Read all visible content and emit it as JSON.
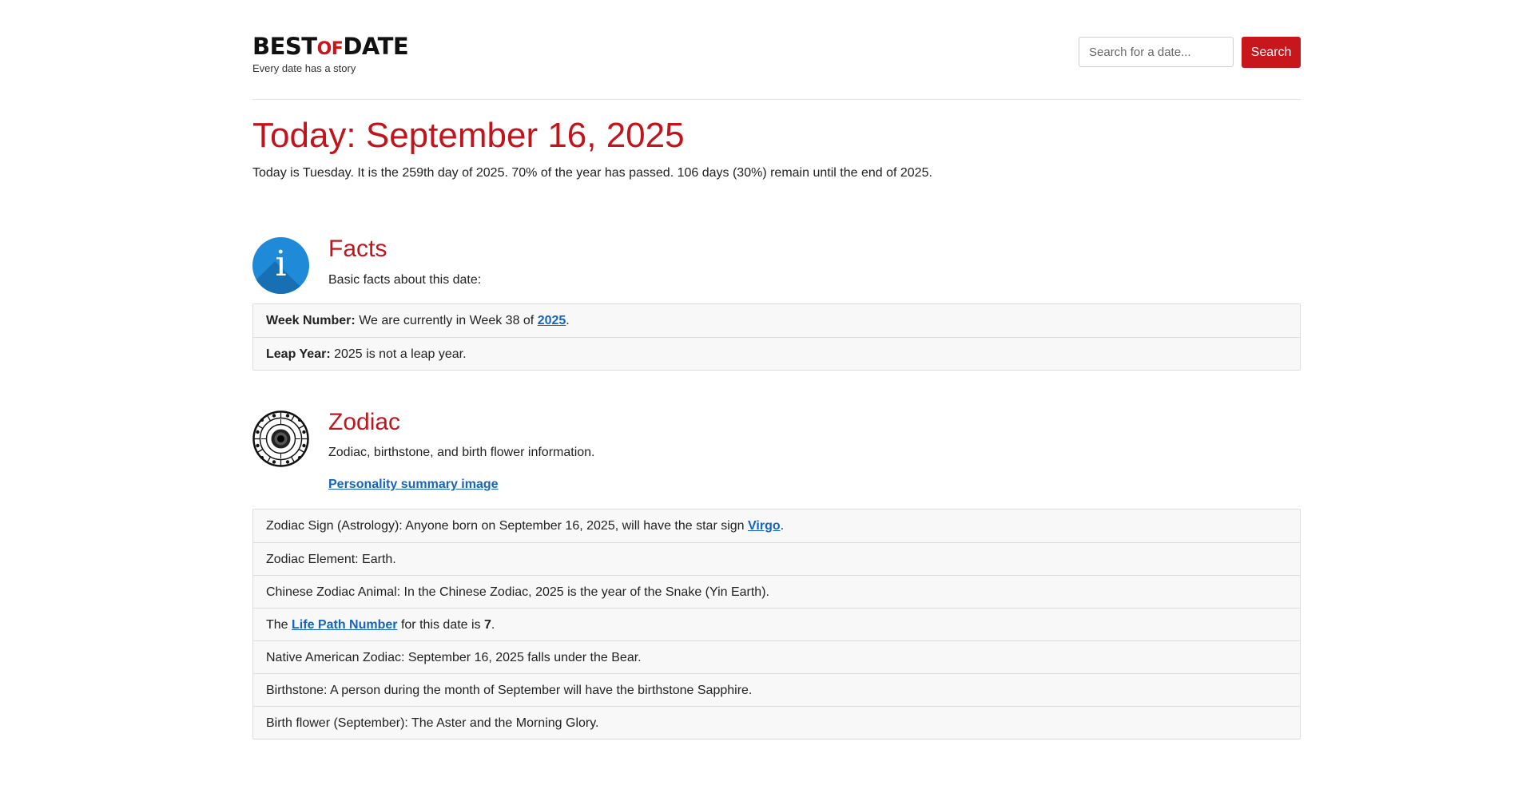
{
  "header": {
    "logo_best": "BEST",
    "logo_of": "OF",
    "logo_date": "DATE",
    "tagline": "Every date has a story",
    "search_placeholder": "Search for a date...",
    "search_button": "Search"
  },
  "title": "Today: September 16, 2025",
  "intro": "Today is Tuesday. It is the 259th day of 2025. 70% of the year has passed. 106 days (30%) remain until the end of 2025.",
  "facts": {
    "icon": "info-icon",
    "title": "Facts",
    "subtitle": "Basic facts about this date:",
    "week_label": "Week Number:",
    "week_text": "We are currently in Week 38 of",
    "week_link": "2025",
    "week_end": ".",
    "leap_label": "Leap Year:",
    "leap_text": "2025 is not a leap year."
  },
  "zodiac": {
    "icon": "zodiac-wheel-icon",
    "title": "Zodiac",
    "subtitle": "Zodiac, birthstone, and birth flower information.",
    "personality_link": "Personality summary image",
    "sign_text": "Zodiac Sign (Astrology): Anyone born on September 16, 2025, will have the star sign",
    "sign_link": "Virgo",
    "sign_end": ".",
    "element": "Zodiac Element: Earth.",
    "chinese": "Chinese Zodiac Animal: In the Chinese Zodiac, 2025 is the year of the Snake (Yin Earth).",
    "life_pre": "The",
    "life_link": "Life Path Number",
    "life_mid": "for this date is",
    "life_num": "7",
    "life_end": ".",
    "native": "Native American Zodiac: September 16, 2025 falls under the Bear.",
    "birthstone": "Birthstone: A person during the month of September will have the birthstone Sapphire.",
    "flower": "Birth flower (September): The Aster and the Morning Glory."
  },
  "colors": {
    "accent": "#c0151c",
    "button": "#c8161d",
    "link": "#1565c0",
    "info_icon_bg": "#1e8ad8"
  }
}
